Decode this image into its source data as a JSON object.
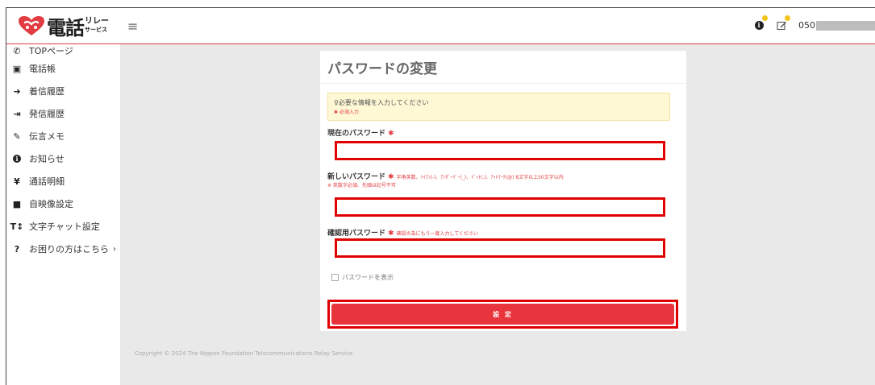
{
  "brand": {
    "logo_text": "電話",
    "logo_sub_top": "リレー",
    "logo_sub_bottom": "サービス",
    "accent": "#e23b41"
  },
  "header": {
    "menu_icon": "hamburger-icon",
    "notification_icon": "info-circle-icon",
    "memo_icon": "edit-icon",
    "phone_prefix": "050"
  },
  "sidebar": {
    "items": [
      {
        "icon": "phone-icon",
        "label": "TOPページ"
      },
      {
        "icon": "address-book-icon",
        "label": "電話帳"
      },
      {
        "icon": "incoming-call-icon",
        "label": "着信履歴"
      },
      {
        "icon": "outgoing-call-icon",
        "label": "発信履歴"
      },
      {
        "icon": "memo-icon",
        "label": "伝言メモ"
      },
      {
        "icon": "info-icon",
        "label": "お知らせ"
      },
      {
        "icon": "yen-icon",
        "label": "通話明細"
      },
      {
        "icon": "video-icon",
        "label": "自映像設定"
      },
      {
        "icon": "text-size-icon",
        "label": "文字チャット設定"
      },
      {
        "icon": "help-icon",
        "label": "お困りの方はこちら"
      }
    ]
  },
  "form": {
    "title": "パスワードの変更",
    "notice_line1": "♀必要な情報を入力してください",
    "notice_line2": "✱ 必須入力",
    "current_label": "現在のパスワード",
    "required_mark": "✱",
    "new_label": "新しいパスワード",
    "new_hint": "半角英数、ﾊｲﾌﾝ(-)、ｱﾝﾀﾞｰﾊﾞｰ(_)、ﾄﾞｯﾄ(.)、ｱｯﾄﾏｰｸ(@) 8文字以上50文字以内",
    "new_hint2": "※ 英数字必須、先頭は記号不可",
    "confirm_label": "確認用パスワード",
    "confirm_hint": "確認の為にもう一度入力してください",
    "show_password_label": "パスワードを表示",
    "submit_label": "設 定"
  },
  "footer": {
    "copyright": "Copyright © 2024 The Nippon Foundation Telecommunications Relay Service"
  }
}
